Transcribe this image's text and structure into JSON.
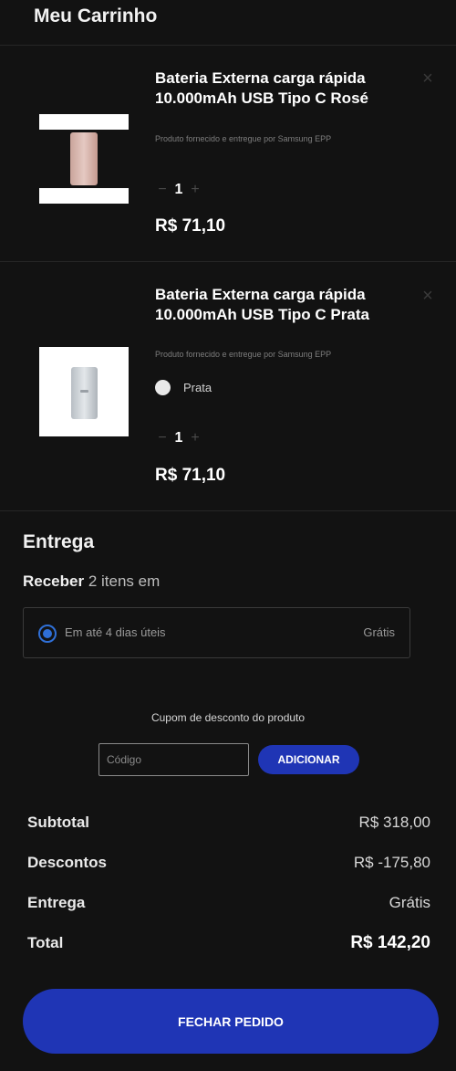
{
  "header": {
    "title": "Meu Carrinho"
  },
  "cart": {
    "items": [
      {
        "name": "Bateria Externa carga rápida 10.000mAh USB Tipo C Rosé",
        "seller": "Produto fornecido e entregue por Samsung EPP",
        "quantity": "1",
        "price": "R$ 71,10",
        "image_icon": "power-bank-rose-image"
      },
      {
        "name": "Bateria Externa carga rápida 10.000mAh USB Tipo C Prata",
        "seller": "Produto fornecido e entregue por Samsung EPP",
        "color_label": "Prata",
        "color_hex": "#e9e9e9",
        "quantity": "1",
        "price": "R$ 71,10",
        "image_icon": "power-bank-silver-image"
      }
    ],
    "minus_glyph": "−",
    "plus_glyph": "+",
    "close_glyph": "×"
  },
  "delivery": {
    "title": "Entrega",
    "receive_label": "Receber",
    "items_text": "2 itens em",
    "option_label": "Em até 4 dias úteis",
    "option_price": "Grátis"
  },
  "coupon": {
    "label": "Cupom de desconto do produto",
    "placeholder": "Código",
    "value": "",
    "add_label": "ADICIONAR"
  },
  "summary": {
    "subtotal_label": "Subtotal",
    "subtotal_value": "R$ 318,00",
    "discount_label": "Descontos",
    "discount_value": "R$ -175,80",
    "shipping_label": "Entrega",
    "shipping_value": "Grátis",
    "total_label": "Total",
    "total_value": "R$ 142,20"
  },
  "checkout": {
    "label": "FECHAR PEDIDO"
  },
  "colors": {
    "accent": "#1f35b5",
    "radio": "#2f6fd6",
    "background": "#121212"
  }
}
